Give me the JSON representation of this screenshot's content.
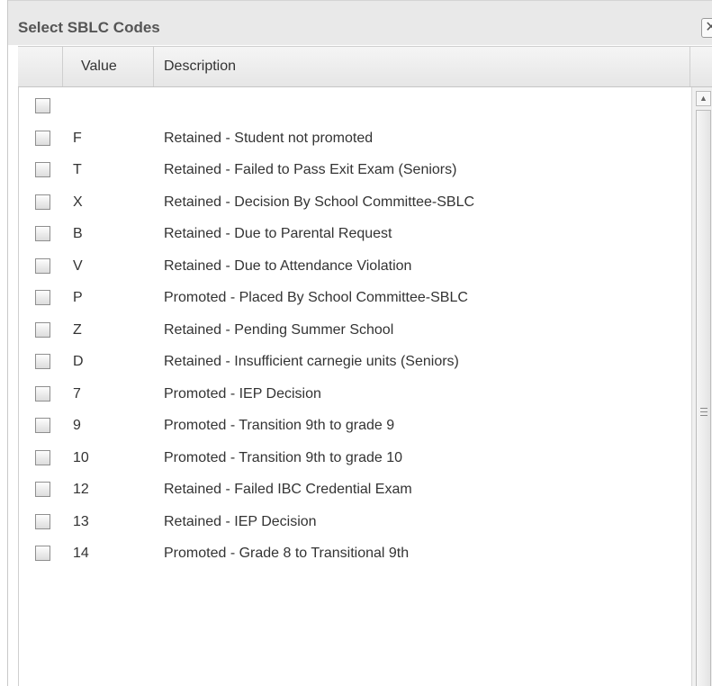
{
  "dialog": {
    "title": "Select SBLC Codes",
    "close_label": "✕"
  },
  "columns": {
    "value_header": "Value",
    "description_header": "Description"
  },
  "rows": [
    {
      "value": "",
      "description": "",
      "checked": false
    },
    {
      "value": "F",
      "description": "Retained - Student not promoted",
      "checked": false
    },
    {
      "value": "T",
      "description": "Retained - Failed to Pass Exit Exam (Seniors)",
      "checked": false
    },
    {
      "value": "X",
      "description": "Retained - Decision By School Committee-SBLC",
      "checked": false
    },
    {
      "value": "B",
      "description": "Retained - Due to Parental Request",
      "checked": false
    },
    {
      "value": "V",
      "description": "Retained - Due to Attendance Violation",
      "checked": false
    },
    {
      "value": "P",
      "description": "Promoted - Placed By School Committee-SBLC",
      "checked": false
    },
    {
      "value": "Z",
      "description": "Retained - Pending Summer School",
      "checked": false
    },
    {
      "value": "D",
      "description": "Retained - Insufficient carnegie units (Seniors)",
      "checked": false
    },
    {
      "value": "7",
      "description": "Promoted - IEP Decision",
      "checked": false
    },
    {
      "value": "9",
      "description": "Promoted - Transition 9th to grade 9",
      "checked": false
    },
    {
      "value": "10",
      "description": "Promoted - Transition 9th to grade 10",
      "checked": false
    },
    {
      "value": "12",
      "description": "Retained - Failed IBC Credential Exam",
      "checked": false
    },
    {
      "value": "13",
      "description": "Retained - IEP Decision",
      "checked": false
    },
    {
      "value": "14",
      "description": "Promoted - Grade 8 to Transitional 9th",
      "checked": false
    }
  ],
  "scrollbar": {
    "up_arrow": "▲"
  },
  "colors": {
    "titlebar_bg": "#e9e9e9",
    "header_bg": "#eeeeee",
    "text": "#333333"
  }
}
